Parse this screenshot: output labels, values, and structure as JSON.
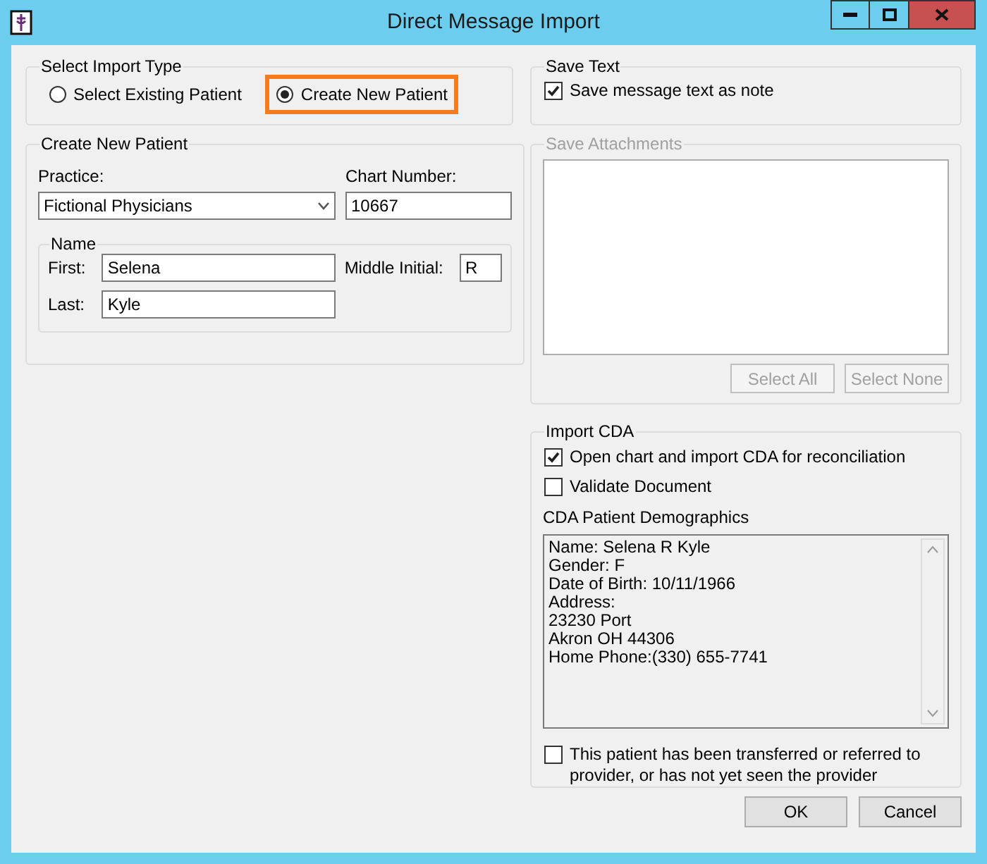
{
  "window": {
    "title": "Direct Message Import"
  },
  "import_type": {
    "title": "Select Import Type",
    "options": [
      {
        "label": "Select Existing Patient",
        "selected": false,
        "highlighted": false
      },
      {
        "label": "Create New Patient",
        "selected": true,
        "highlighted": true
      }
    ]
  },
  "new_patient": {
    "title": "Create New Patient",
    "practice": {
      "label": "Practice:",
      "value": "Fictional Physicians"
    },
    "chart_number": {
      "label": "Chart Number:",
      "value": "10667"
    },
    "name": {
      "title": "Name",
      "first": {
        "label": "First:",
        "value": "Selena"
      },
      "middle": {
        "label": "Middle Initial:",
        "value": "R"
      },
      "last": {
        "label": "Last:",
        "value": "Kyle"
      }
    }
  },
  "save_text": {
    "title": "Save Text",
    "checkbox": {
      "label": "Save message text as note",
      "checked": true
    }
  },
  "save_attachments": {
    "title": "Save Attachments",
    "disabled": true,
    "buttons": [
      {
        "label": "Select All",
        "disabled": true
      },
      {
        "label": "Select None",
        "disabled": true
      }
    ]
  },
  "import_cda": {
    "title": "Import CDA",
    "options": [
      {
        "label": "Open chart and import CDA for reconciliation",
        "checked": true
      },
      {
        "label": "Validate Document",
        "checked": false
      }
    ],
    "demographics": {
      "label": "CDA Patient Demographics",
      "lines": [
        "Name: Selena R Kyle",
        "Gender: F",
        "Date of Birth: 10/11/1966",
        "Address:",
        "23230 Port",
        "Akron OH 44306",
        "Home Phone:(330) 655-7741"
      ]
    },
    "referral": {
      "label": "This patient has been transferred or referred to provider, or has not yet seen the provider",
      "checked": false
    }
  },
  "buttons": [
    {
      "label": "OK",
      "disabled": false
    },
    {
      "label": "Cancel",
      "disabled": false
    }
  ]
}
